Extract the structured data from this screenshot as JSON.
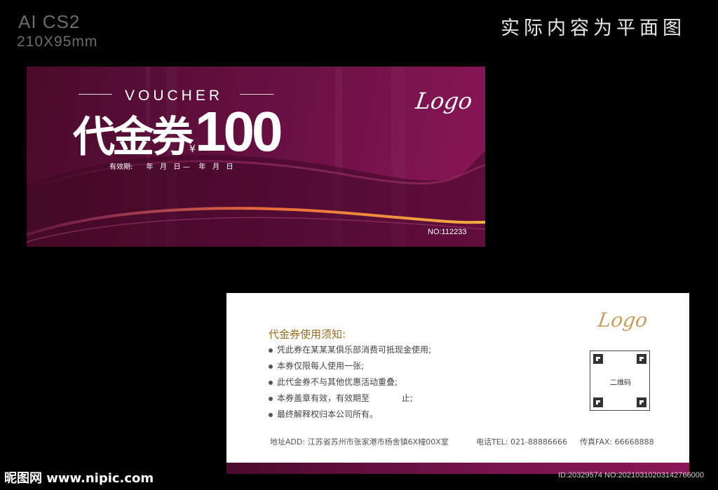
{
  "spec": {
    "software": "AI CS2",
    "size": "210X95mm"
  },
  "note": "实际内容为平面图",
  "front": {
    "voucher_word": "VOUCHER",
    "title": "代金券",
    "currency_symbol": "¥",
    "amount": "100",
    "validity": "有效期:      年   月   日 —    年   月   日",
    "logo": "Logo",
    "serial": "NO:112233"
  },
  "back": {
    "logo": "Logo",
    "rules_title": "代金券使用须知:",
    "rules": [
      "凭此券在某某某俱乐部消费可抵现金使用;",
      "本券仅限每人使用一张;",
      "此代金券不与其他优惠活动重叠;",
      "本券盖章有效，有效期至            止;",
      "最终解释权归本公司所有。"
    ],
    "qr_label": "二维码",
    "address": "地址ADD: 江苏省苏州市张家港市杨舍镇6X幢00X室",
    "phone": "电话TEL: 021-88886666",
    "fax": "传真FAX: 66668888"
  },
  "watermark": {
    "site": "昵图网 www.nipic.com",
    "id": "ID:20329574 NO:20210310203142766000"
  },
  "colors": {
    "front_dark": "#4a0b2c",
    "front_light": "#8a1658",
    "orange_swoosh": "#f0a030",
    "gold": "#9a6d1e"
  }
}
